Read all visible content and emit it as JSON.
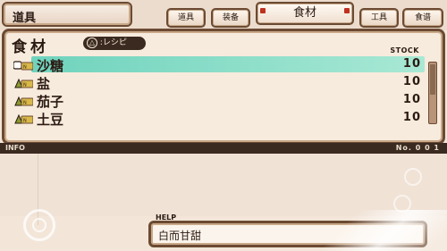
{
  "top_bar": {
    "title": "道具",
    "tabs": [
      {
        "label": "道具",
        "active": false
      },
      {
        "label": "装备",
        "active": false
      },
      {
        "label": "食材",
        "active": true
      },
      {
        "label": "工具",
        "active": false
      },
      {
        "label": "食谱",
        "active": false
      }
    ]
  },
  "panel": {
    "category_title": "食材",
    "recipe_button": {
      "glyph": "△",
      "label": ":レシピ"
    },
    "stock_header": "STOCK",
    "items": [
      {
        "name": "沙糖",
        "stock": "10",
        "selected": true,
        "icon": "new-badge-cursor-icon"
      },
      {
        "name": "盐",
        "stock": "10",
        "selected": false,
        "icon": "new-badge-icon"
      },
      {
        "name": "茄子",
        "stock": "10",
        "selected": false,
        "icon": "new-badge-icon"
      },
      {
        "name": "土豆",
        "stock": "10",
        "selected": false,
        "icon": "new-badge-icon"
      }
    ]
  },
  "info_bar": {
    "label": "INFO",
    "number": "No. 0 0 1"
  },
  "help": {
    "label": "HELP",
    "text": "白而甘甜"
  },
  "colors": {
    "selection": "#6fd3bd",
    "wood": "#6b4a33",
    "parchment": "#f7ebdd"
  }
}
